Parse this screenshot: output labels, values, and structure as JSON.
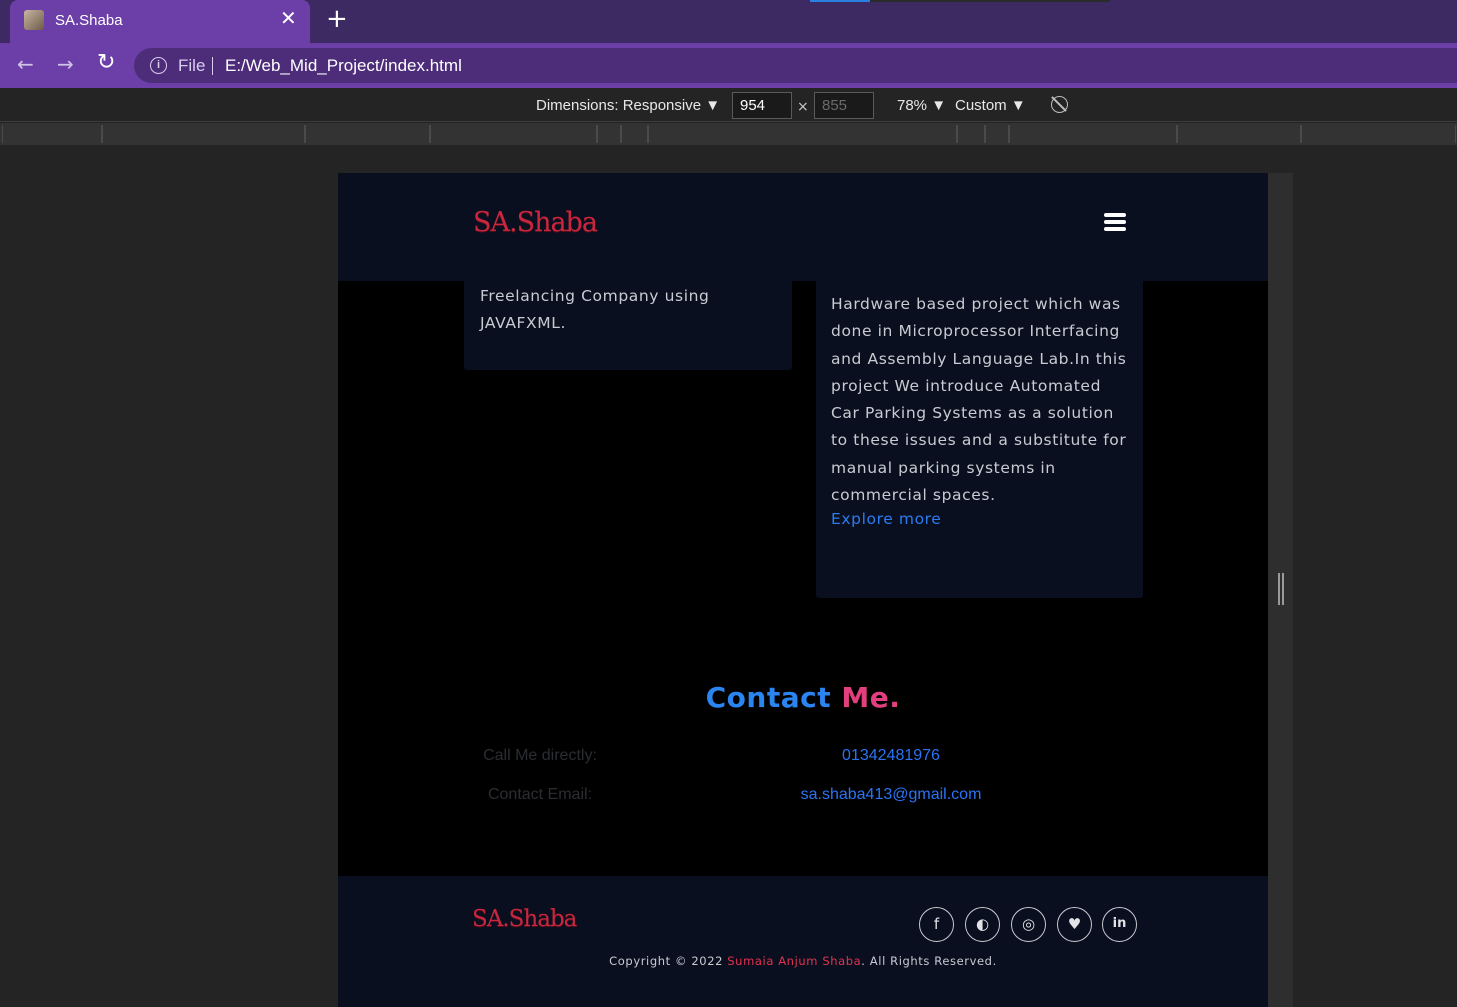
{
  "browser": {
    "tab_title": "SA.Shaba",
    "tab_close": "✕",
    "new_tab": "+",
    "nav_back": "←",
    "nav_forward": "→",
    "nav_reload": "↻",
    "info_symbol": "i",
    "scheme": "File",
    "url": "E:/Web_Mid_Project/index.html"
  },
  "devtools": {
    "dimensions_label": "Dimensions: Responsive ▼",
    "width": "954",
    "height_placeholder": "855",
    "times": "×",
    "zoom": "78% ▼",
    "throttling": "Custom ▼"
  },
  "site": {
    "logo": "SA.Shaba",
    "left_card_text": "Freelancing Company using JAVAFXML.",
    "right_card_text": "Hardware based project which was done in Microprocessor Interfacing and Assembly Language Lab.In this project We introduce Automated Car Parking Systems as a solution to these issues and a substitute for manual parking systems in commercial spaces.",
    "explore_link": "Explore more",
    "contact": {
      "heading_part1": "Contact",
      "heading_part2": "Me.",
      "phone_label": "Call Me directly:",
      "phone_value": "01342481976",
      "email_label": "Contact Email:",
      "email_value": "sa.shaba413@gmail.com"
    },
    "footer": {
      "logo": "SA.Shaba",
      "social_icons": [
        "facebook-icon",
        "github-icon",
        "instagram-icon",
        "twitter-icon",
        "linkedin-icon"
      ],
      "social_glyphs": [
        "f",
        "◐",
        "◎",
        "♥",
        "in"
      ],
      "copyright_prefix": "Copyright © 2022 ",
      "copyright_name": "Sumaia Anjum Shaba",
      "copyright_suffix": ". All Rights Reserved."
    }
  },
  "colors": {
    "tab_bg": "#6c3fa8",
    "site_bg": "#0a0f1f",
    "logo_red": "#c8273f",
    "link_blue": "#2a7cf0",
    "heading_blue": "#2a85f0",
    "heading_pink": "#e13f7d"
  }
}
